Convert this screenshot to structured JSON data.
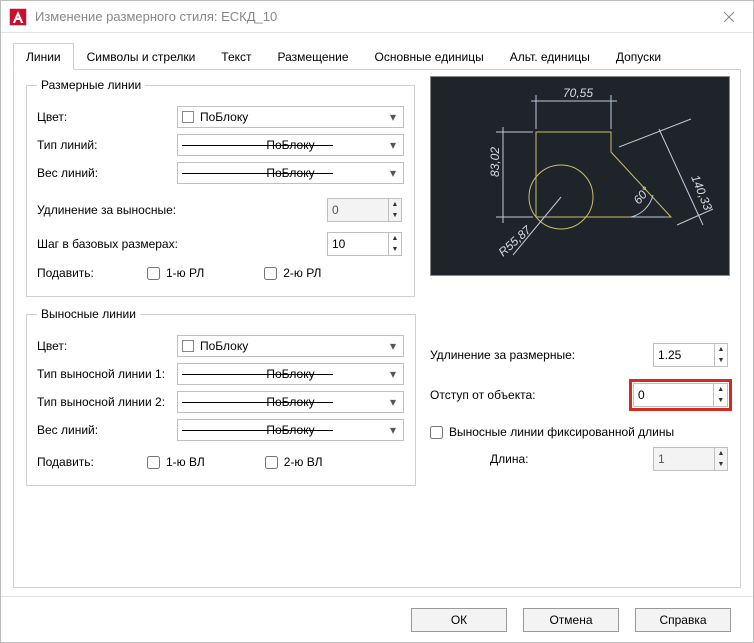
{
  "window": {
    "title": "Изменение размерного стиля: ЕСКД_10"
  },
  "tabs": [
    "Линии",
    "Символы и стрелки",
    "Текст",
    "Размещение",
    "Основные единицы",
    "Альт. единицы",
    "Допуски"
  ],
  "active_tab": 0,
  "dim_lines": {
    "legend": "Размерные линии",
    "color_label": "Цвет:",
    "color_value": "ПоБлоку",
    "ltype_label": "Тип линий:",
    "ltype_value": "ПоБлоку",
    "lweight_label": "Вес линий:",
    "lweight_value": "ПоБлоку",
    "extend_label": "Удлинение за выносные:",
    "extend_value": "0",
    "baseline_label": "Шаг в базовых размерах:",
    "baseline_value": "10",
    "suppress_label": "Подавить:",
    "sup1": "1-ю РЛ",
    "sup2": "2-ю РЛ"
  },
  "ext_lines": {
    "legend": "Выносные линии",
    "color_label": "Цвет:",
    "color_value": "ПоБлоку",
    "lt1_label": "Тип выносной линии 1:",
    "lt1_value": "ПоБлоку",
    "lt2_label": "Тип выносной линии 2:",
    "lt2_value": "ПоБлоку",
    "lweight_label": "Вес линий:",
    "lweight_value": "ПоБлоку",
    "suppress_label": "Подавить:",
    "sup1": "1-ю ВЛ",
    "sup2": "2-ю ВЛ",
    "ext_beyond_label": "Удлинение за размерные:",
    "ext_beyond_value": "1.25",
    "offset_label": "Отступ от объекта:",
    "offset_value": "0",
    "fixed_label": "Выносные линии фиксированной длины",
    "length_label": "Длина:",
    "length_value": "1"
  },
  "preview_labels": {
    "top": "70,55",
    "left": "83,02",
    "right": "140,33",
    "angle": "60°",
    "radius": "R55,87"
  },
  "footer": {
    "ok": "ОК",
    "cancel": "Отмена",
    "help": "Справка"
  }
}
